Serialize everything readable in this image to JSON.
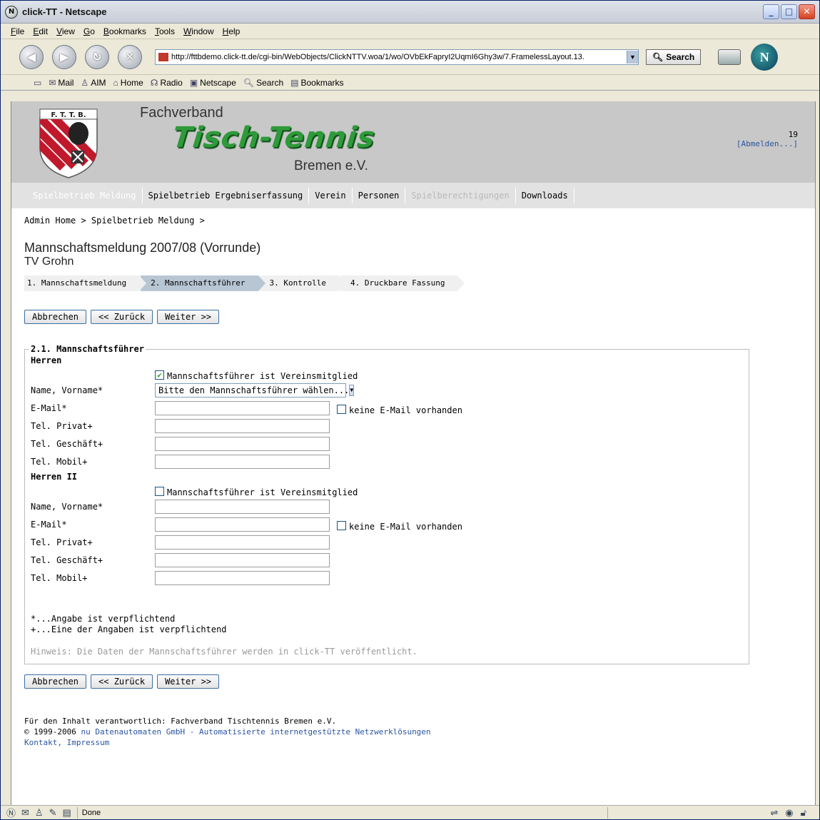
{
  "window": {
    "title": "click-TT - Netscape",
    "controls": [
      "_",
      "□",
      "✕"
    ]
  },
  "menu": [
    "File",
    "Edit",
    "View",
    "Go",
    "Bookmarks",
    "Tools",
    "Window",
    "Help"
  ],
  "toolbar": {
    "url": "http://fttbdemo.click-tt.de/cgi-bin/WebObjects/ClickNTTV.woa/1/wo/OVbEkFapryI2UqmI6Ghy3w/7.FramelessLayout.13.",
    "search_label": "Search"
  },
  "personal_toolbar": [
    "Mail",
    "AIM",
    "Home",
    "Radio",
    "Netscape",
    "Search",
    "Bookmarks"
  ],
  "banner": {
    "crest_text": "F. T. T. B.",
    "line1": "Fachverband",
    "line2": "Tisch-Tennis",
    "line3": "Bremen e.V.",
    "user_number": "19",
    "logout": "[Abmelden...]"
  },
  "nav": [
    {
      "label": "Spielbetrieb Meldung",
      "state": "active"
    },
    {
      "label": "Spielbetrieb Ergebniserfassung",
      "state": "normal"
    },
    {
      "label": "Verein",
      "state": "normal"
    },
    {
      "label": "Personen",
      "state": "normal"
    },
    {
      "label": "Spielberechtigungen",
      "state": "disabled"
    },
    {
      "label": "Downloads",
      "state": "normal"
    }
  ],
  "breadcrumb": "Admin Home > Spielbetrieb Meldung >",
  "page": {
    "title": "Mannschaftsmeldung 2007/08 (Vorrunde)",
    "club": "TV Grohn"
  },
  "steps": [
    {
      "label": "1. Mannschaftsmeldung",
      "active": false
    },
    {
      "label": "2. Mannschaftsführer",
      "active": true
    },
    {
      "label": "3. Kontrolle",
      "active": false
    },
    {
      "label": "4. Druckbare Fassung",
      "active": false
    }
  ],
  "buttons": {
    "cancel": "Abbrechen",
    "back": "<< Zurück",
    "next": "Weiter >>"
  },
  "form": {
    "legend": "2.1. Mannschaftsführer",
    "member_checkbox": "Mannschaftsführer ist Vereinsmitglied",
    "no_email_checkbox": "keine E-Mail vorhanden",
    "select_placeholder": "Bitte den Mannschaftsführer wählen...",
    "labels": {
      "name": "Name, Vorname*",
      "email": "E-Mail*",
      "tel_private": "Tel. Privat+",
      "tel_business": "Tel. Geschäft+",
      "tel_mobile": "Tel. Mobil+"
    },
    "teams": [
      {
        "name": "Herren",
        "member_checked": true
      },
      {
        "name": "Herren II",
        "member_checked": false
      }
    ],
    "notes": {
      "required": "*...Angabe ist verpflichtend",
      "one_of": "+...Eine der Angaben ist verpflichtend"
    },
    "hint": "Hinweis: Die Daten der Mannschaftsführer werden in click-TT veröffentlicht."
  },
  "footer": {
    "responsible": "Für den Inhalt verantwortlich: Fachverband Tischtennis Bremen e.V.",
    "copyright_prefix": "© 1999-2006",
    "copyright_link": "nu Datenautomaten GmbH - Automatisierte internetgestützte Netzwerklösungen",
    "contact": "Kontakt, Impressum"
  },
  "status": {
    "text": "Done"
  }
}
